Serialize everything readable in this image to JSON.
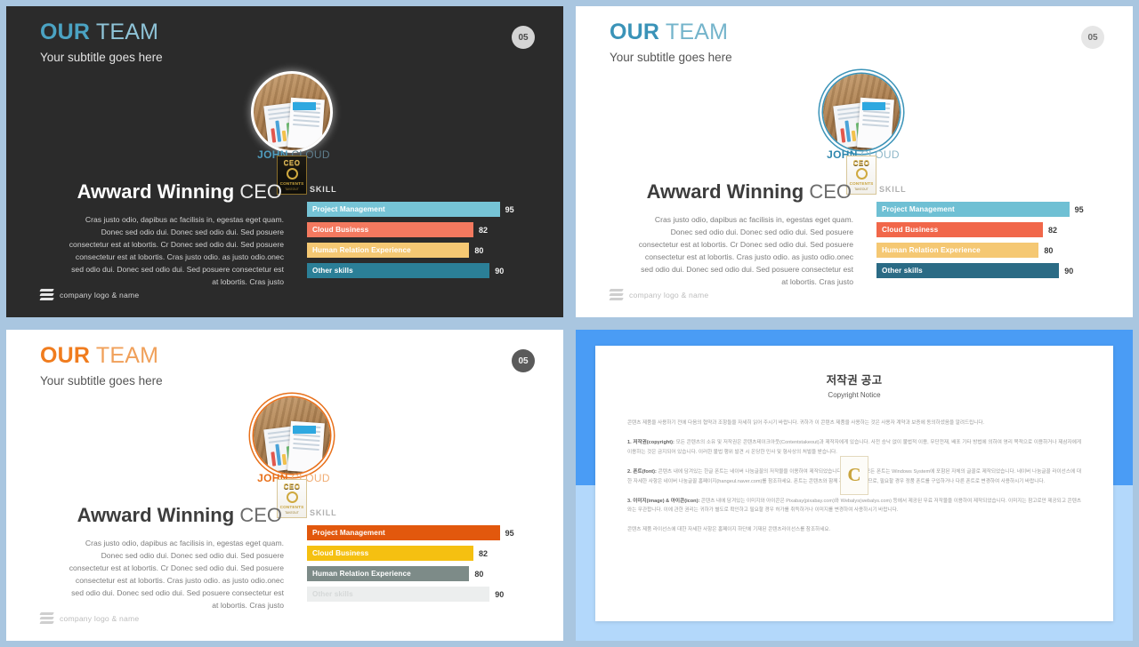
{
  "common": {
    "header": {
      "title_bold": "OUR",
      "title_light": "TEAM",
      "subtitle": "Your subtitle goes here"
    },
    "page_number": "05",
    "person": {
      "first": "JOHN",
      "last": "CLOUD"
    },
    "badge": {
      "ceo": "CEO",
      "line1": "CONTENTS",
      "line2": "TAKEOUT"
    },
    "headline": {
      "bold": "Awward Winning",
      "light": "CEO"
    },
    "body": "Cras justo odio, dapibus ac facilisis in, egestas eget quam. Donec sed odio dui. Donec sed odio dui. Sed posuere consectetur est at lobortis. Cr Donec sed odio dui. Sed posuere consectetur est at lobortis. Cras justo odio. as justo odio.onec sed odio dui. Donec sed odio dui. Sed posuere consectetur est at lobortis. Cras justo",
    "skill_label": "SKILL",
    "footer": "company logo & name"
  },
  "chart_data": {
    "type": "bar",
    "title": "SKILL",
    "categories": [
      "Project Management",
      "Cloud Business",
      "Human Relation Experience",
      "Other skills"
    ],
    "values": [
      95,
      82,
      80,
      90
    ],
    "xlim": [
      0,
      100
    ],
    "orientation": "horizontal",
    "grid": false,
    "legend": "none",
    "themes": {
      "dark": {
        "colors": [
          "#76c4d6",
          "#f4795f",
          "#f5c873",
          "#2b7f97"
        ],
        "accent": "#4ba3c3"
      },
      "teal": {
        "colors": [
          "#6fc0d4",
          "#f1674a",
          "#f5c873",
          "#2b6b85"
        ],
        "accent": "#3a93b8"
      },
      "orange": {
        "colors": [
          "#e2580d",
          "#f5c011",
          "#7d8b88",
          "#eceeee"
        ],
        "accent": "#f07c1e"
      }
    }
  },
  "slides": [
    {
      "id": "slide-dark",
      "theme": "dark",
      "bar_colors": [
        "#76c4d6",
        "#f4795f",
        "#f5c873",
        "#2b7f97"
      ],
      "bar_text_colors": [
        "#ffffff",
        "#ffffff",
        "#ffffff",
        "#ffffff"
      ]
    },
    {
      "id": "slide-teal",
      "theme": "teal",
      "bar_colors": [
        "#6fc0d4",
        "#f1674a",
        "#f5c873",
        "#2b6b85"
      ],
      "bar_text_colors": [
        "#ffffff",
        "#ffffff",
        "#ffffff",
        "#ffffff"
      ]
    },
    {
      "id": "slide-orange",
      "theme": "orange",
      "bar_colors": [
        "#e2580d",
        "#f5c011",
        "#7d8b88",
        "#eceeee"
      ],
      "bar_text_colors": [
        "#ffffff",
        "#ffffff",
        "#ffffff",
        "#d5d8d8"
      ]
    }
  ],
  "copyright": {
    "title": "저작권 공고",
    "subtitle": "Copyright Notice",
    "watermark_glyph": "C",
    "paragraphs": [
      "콘텐츠 제품을 사용하기 전에 다음의 협약과 조항들을 자세히 읽어 주시기 바랍니다. 귀하가 이 콘텐츠 제품을 사용하는 것은 사용자 계약과 보증에 동의하셨음을 알려드립니다.",
      "1. 저작권(copyright): 모든 콘텐츠의 소유 및 저작권은 콘텐츠테이크아웃(Contentstakeout)과 제작자에게 있습니다. 사전 승낙 없이 불법적 이용, 무단전재, 배포 기타 방법에 의하여 영리 목적으로 이용하거나 제삼자에게 이용하는 것은 금지되어 있습니다. 이러한 불법 행위 발견 시 온당한 민사 및 형사상의 처벌을 받습니다.",
      "2. 폰트(font): 콘텐츠 내에 담겨있는 한글 폰트는 네이버 나눔글꼴의 저작물을 이용하여 제작되었습니다. 한글 외의 모든 폰트는 Windows System에 포함된 자체의 글꼴로 제작되었습니다. 네이버 나눔글꼴 라이선스에 대한 자세한 사항은 네이버 나눔글꼴 홈페이지(hangeul.naver.com)를 참조하세요. 폰트는 콘텐츠와 함께 제공되지 않으므로, 필요할 경우 정품 폰트를 구입하거나 다른 폰트로 변경하여 사용하시기 바랍니다.",
      "3. 이미지(image) & 아이콘(icon): 콘텐츠 내에 담겨있는 이미지와 아이콘은 Pixabay(pixabay.com)와 Webalys(webalys.com) 등에서 제공된 무료 저작물을 이용하여 제작되었습니다. 이미지는 참고로만 제공되고 콘텐츠와는 무관합니다. 이에 관한 권리는 귀하가 별도로 확인하고 필요할 경우 허가를 취득하거나 이미지를 변경하여 사용하시기 바랍니다.",
      "콘텐츠 제품 라이선스에 대한 자세한 사항은 홈페이지 하단에 기재된 콘텐츠라이선스를 참조하세요."
    ]
  }
}
